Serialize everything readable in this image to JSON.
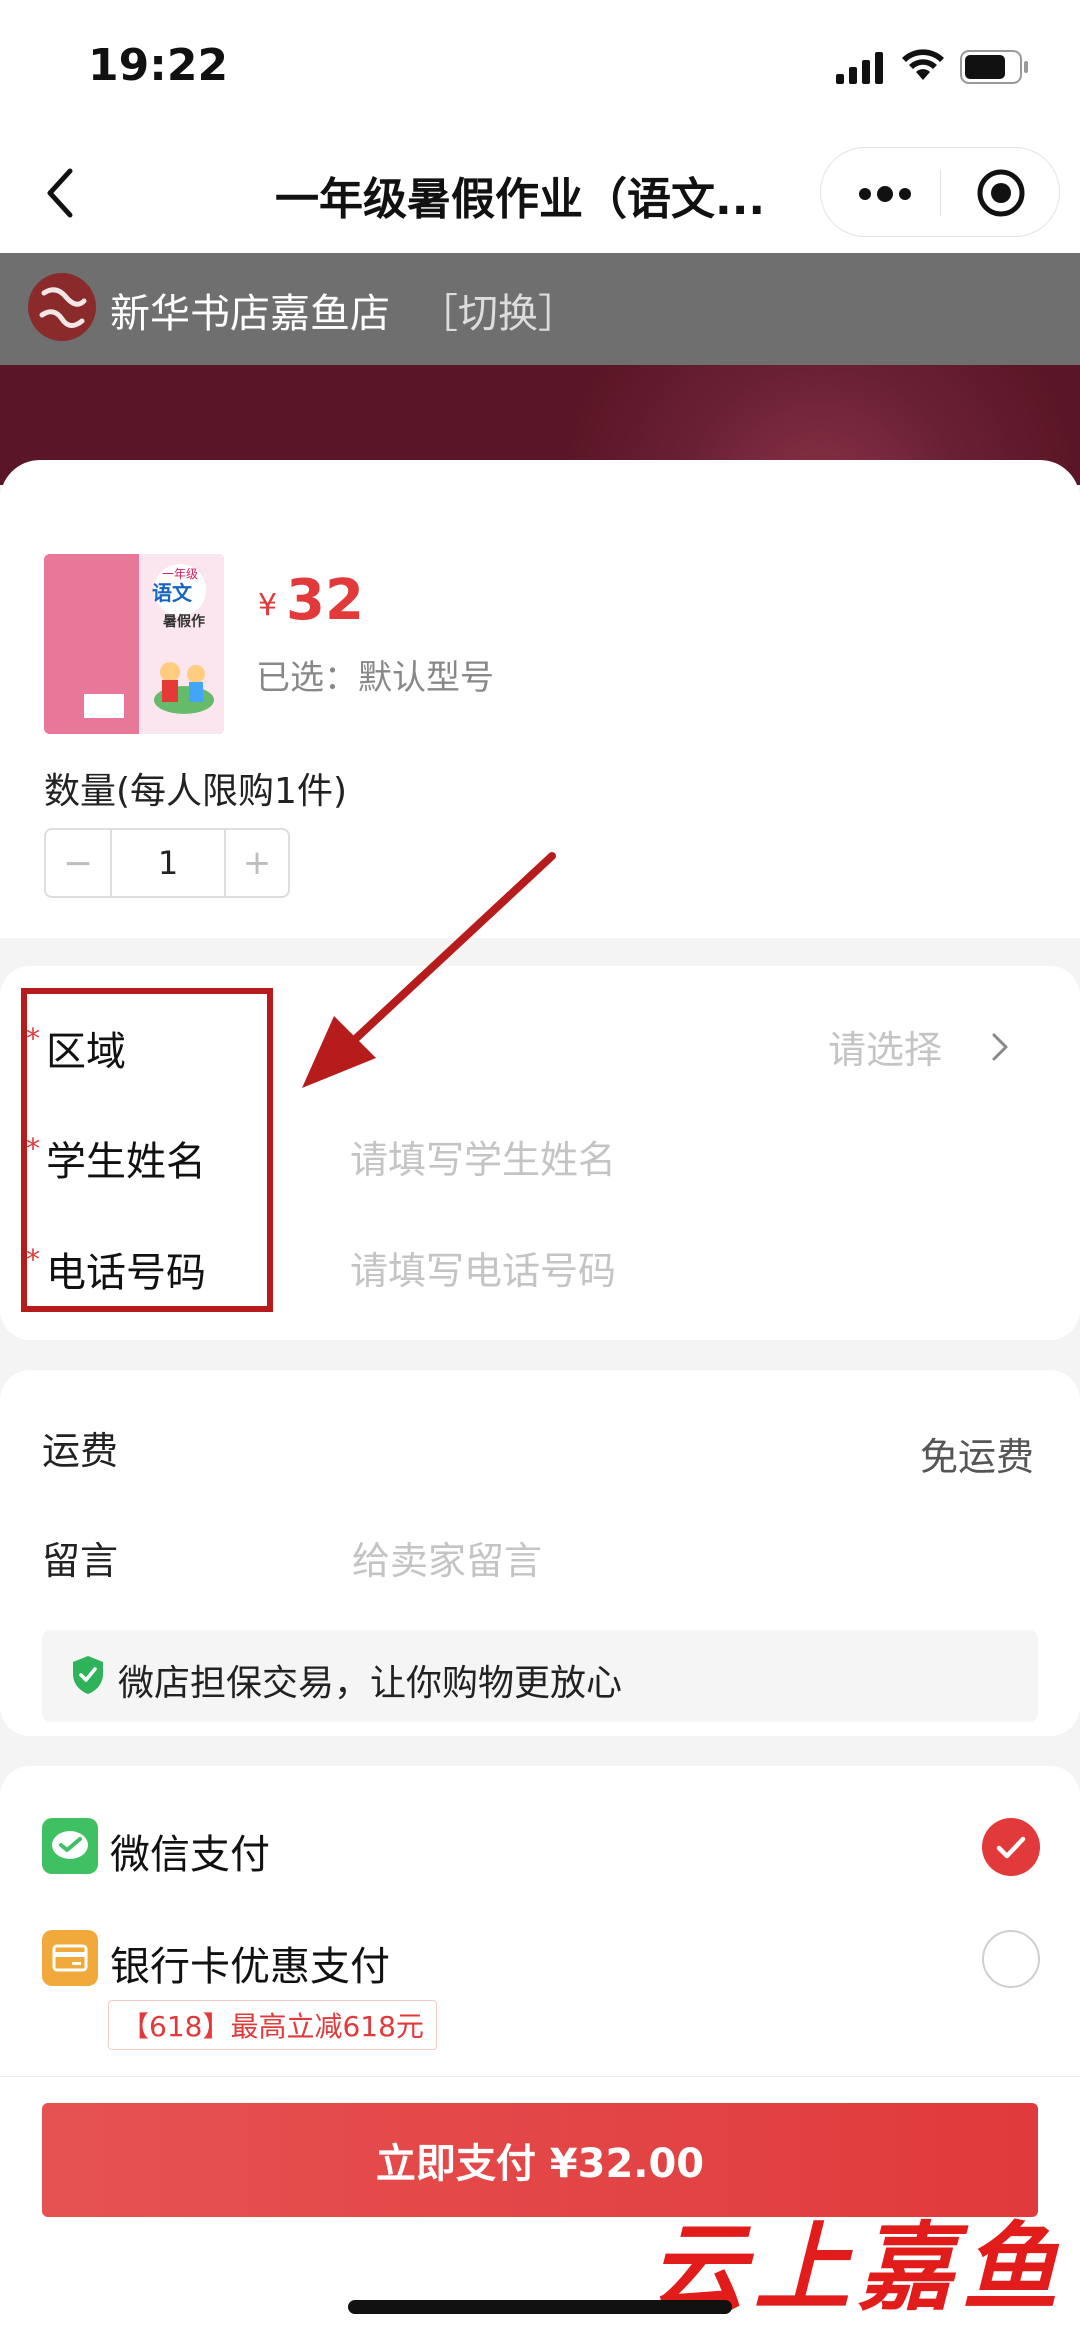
{
  "status_bar": {
    "time": "19:22"
  },
  "nav": {
    "title": "一年级暑假作业（语文..."
  },
  "shop": {
    "name": "新华书店嘉鱼店",
    "switch_label": "［切换］"
  },
  "product": {
    "price_symbol": "¥",
    "price": "32",
    "selected_spec": "已选：默认型号",
    "cover_text": {
      "grade": "一年级",
      "subject": "语文",
      "type": "暑假作"
    }
  },
  "quantity": {
    "label": "数量(每人限购1件)",
    "minus": "−",
    "value": "1",
    "plus": "+"
  },
  "form": {
    "required_mark": "*",
    "region": {
      "label": "区域",
      "placeholder": "请选择"
    },
    "student_name": {
      "label": "学生姓名",
      "placeholder": "请填写学生姓名"
    },
    "phone": {
      "label": "电话号码",
      "placeholder": "请填写电话号码"
    }
  },
  "info": {
    "shipping_label": "运费",
    "shipping_value": "免运费",
    "note_label": "留言",
    "note_placeholder": "给卖家留言",
    "guarantee_text": "微店担保交易，让你购物更放心"
  },
  "payment": {
    "wechat_label": "微信支付",
    "bank_label": "银行卡优惠支付",
    "promo_tag": "【618】最高立减618元"
  },
  "pay_button": "立即支付 ¥32.00",
  "watermark": "云上嘉鱼",
  "colors": {
    "accent": "#e2393b",
    "wechat": "#3fc063",
    "bank": "#f2a93b",
    "annotation": "#b71c1c"
  }
}
